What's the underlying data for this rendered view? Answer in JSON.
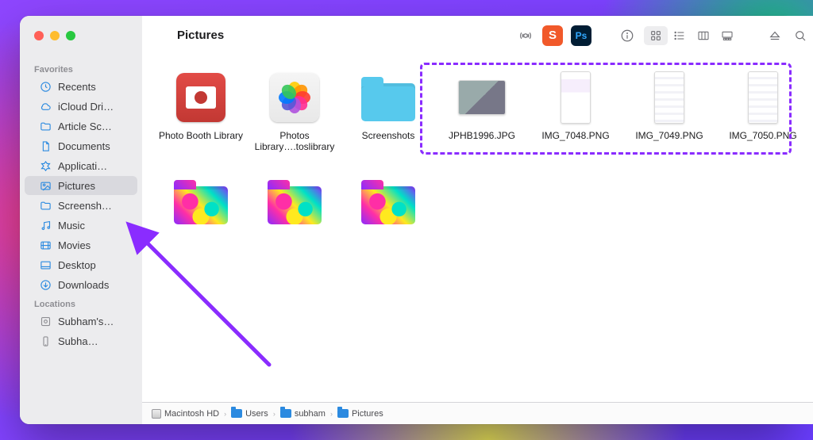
{
  "window": {
    "title": "Pictures"
  },
  "toolbar": {
    "ext_apps": [
      {
        "name": "swoosh-app",
        "letter": "S"
      },
      {
        "name": "photoshop-app",
        "letter": "Ps"
      }
    ]
  },
  "sidebar": {
    "sections": [
      {
        "header": "Favorites",
        "items": [
          {
            "icon": "clock",
            "label": "Recents"
          },
          {
            "icon": "cloud",
            "label": "iCloud Dri…"
          },
          {
            "icon": "folder",
            "label": "Article Sc…"
          },
          {
            "icon": "doc",
            "label": "Documents"
          },
          {
            "icon": "app",
            "label": "Applicati…"
          },
          {
            "icon": "picture",
            "label": "Pictures",
            "selected": true
          },
          {
            "icon": "folder",
            "label": "Screensh…"
          },
          {
            "icon": "music",
            "label": "Music"
          },
          {
            "icon": "movie",
            "label": "Movies"
          },
          {
            "icon": "desktop",
            "label": "Desktop"
          },
          {
            "icon": "download",
            "label": "Downloads"
          }
        ]
      },
      {
        "header": "Locations",
        "items": [
          {
            "icon": "disk",
            "label": "Subham's…",
            "gray": true
          },
          {
            "icon": "phone",
            "label": "Subha…",
            "gray": true
          }
        ]
      }
    ]
  },
  "files": {
    "row1": [
      {
        "kind": "app-red",
        "label": "Photo Booth Library"
      },
      {
        "kind": "app-photos",
        "label": "Photos Library….toslibrary"
      },
      {
        "kind": "folder",
        "label": "Screenshots"
      },
      {
        "kind": "img-photo",
        "label": "JPHB1996.JPG"
      },
      {
        "kind": "img-ui1",
        "label": "IMG_7048.PNG"
      },
      {
        "kind": "img-ui2",
        "label": "IMG_7049.PNG"
      },
      {
        "kind": "img-ui3",
        "label": "IMG_7050.PNG"
      }
    ],
    "row2": [
      {
        "kind": "folder-psy",
        "label": ""
      },
      {
        "kind": "folder-psy",
        "label": ""
      },
      {
        "kind": "folder-psy",
        "label": ""
      }
    ]
  },
  "pathbar": [
    {
      "icon": "disk",
      "label": "Macintosh HD"
    },
    {
      "icon": "folder",
      "label": "Users"
    },
    {
      "icon": "folder",
      "label": "subham"
    },
    {
      "icon": "folder",
      "label": "Pictures"
    }
  ]
}
